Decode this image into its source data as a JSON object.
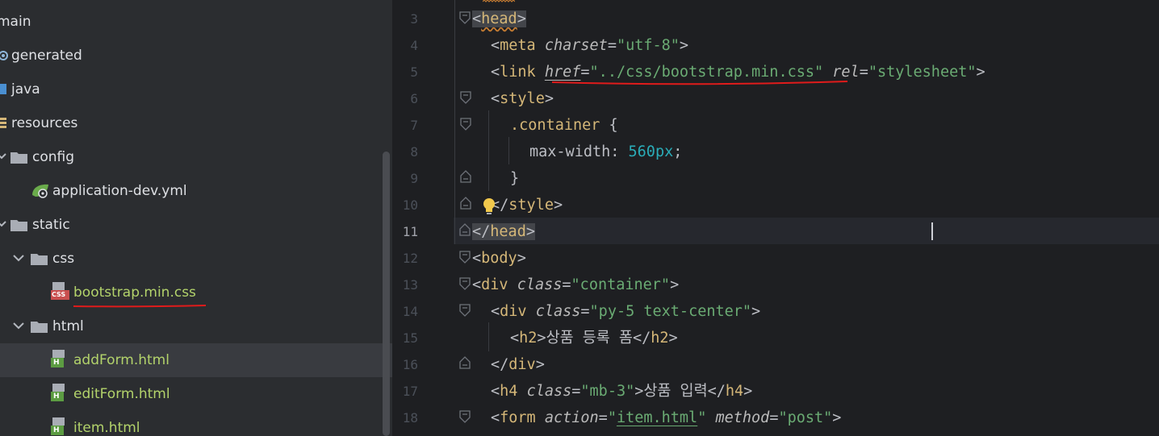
{
  "project_tree": {
    "items": [
      {
        "label": "main",
        "kind": "folder-partial"
      },
      {
        "label": "generated",
        "kind": "generated"
      },
      {
        "label": "java",
        "kind": "source"
      },
      {
        "label": "resources",
        "kind": "resources"
      },
      {
        "label": "config",
        "kind": "folder"
      },
      {
        "label": "application-dev.yml",
        "kind": "spring-yml"
      },
      {
        "label": "static",
        "kind": "folder"
      },
      {
        "label": "css",
        "kind": "folder"
      },
      {
        "label": "bootstrap.min.css",
        "kind": "css-file"
      },
      {
        "label": "html",
        "kind": "folder"
      },
      {
        "label": "addForm.html",
        "kind": "html-file"
      },
      {
        "label": "editForm.html",
        "kind": "html-file"
      },
      {
        "label": "item.html",
        "kind": "html-file"
      }
    ],
    "selected_item": "addForm.html",
    "css_icon_text": "CSS",
    "html_icon_text": "H"
  },
  "editor": {
    "line_numbers": [
      "3",
      "4",
      "5",
      "6",
      "7",
      "8",
      "9",
      "10",
      "11",
      "12",
      "13",
      "14",
      "15",
      "16",
      "17",
      "18"
    ],
    "active_line": "11",
    "lines": {
      "l3": "<head>",
      "l4_attr": "charset",
      "l4_val": "\"utf-8\"",
      "l5_href": "href",
      "l5_href_val": "\"../css/bootstrap.min.css\"",
      "l5_rel": "rel",
      "l5_rel_val": "\"stylesheet\"",
      "l7_selector": ".container",
      "l8_prop": "max-width: ",
      "l8_val": "560px",
      "l13_class_val": "\"container\"",
      "l14_class_val": "\"py-5 text-center\"",
      "l15_text": "상품 등록 폼",
      "l17_class_val": "\"mb-3\"",
      "l17_text": "상품 입력",
      "l18_action_val": "item.html",
      "l18_method_val": "\"post\""
    }
  },
  "colors": {
    "tree_bg": "#2b2d30",
    "editor_bg": "#1e1f22",
    "tag": "#d5b778",
    "string": "#6aab73",
    "number": "#2aacb8",
    "annotation_red": "#e01b1b",
    "html_file_green": "#b3d36b"
  }
}
